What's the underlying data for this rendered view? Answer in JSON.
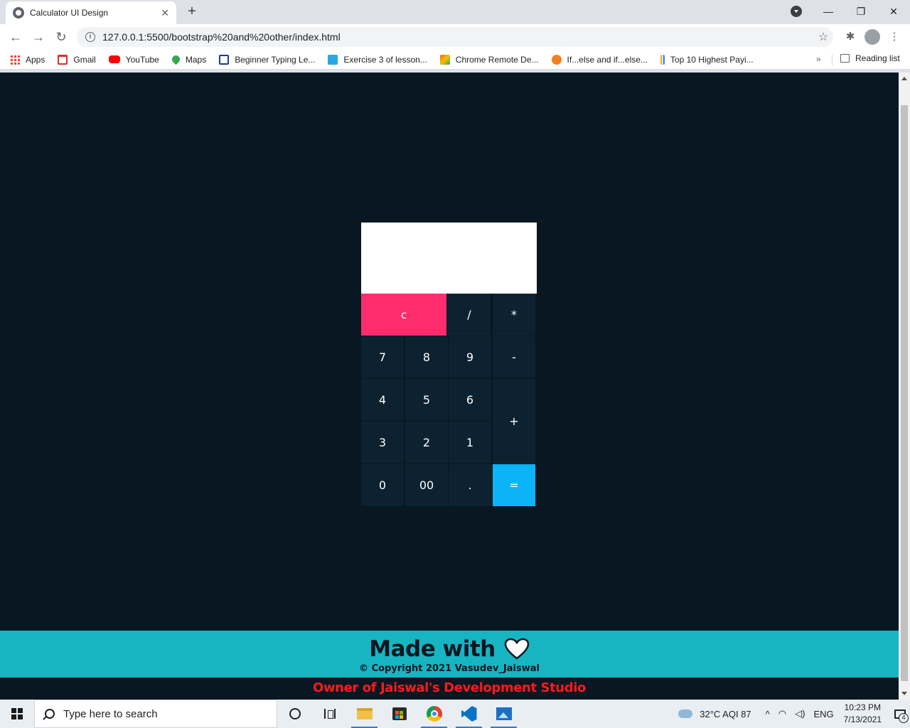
{
  "browser": {
    "tab_title": "Calculator UI Design",
    "tab_close": "✕",
    "new_tab": "+",
    "url": "127.0.0.1:5500/bootstrap%20and%20other/index.html",
    "window_controls": {
      "minimize": "—",
      "restore": "❐",
      "close": "✕"
    },
    "nav": {
      "back": "←",
      "forward": "→",
      "reload": "↻"
    },
    "star": "☆",
    "extensions": "✱",
    "menu": "⋮",
    "bookmarks": [
      {
        "label": "Apps",
        "color": "#ea4335"
      },
      {
        "label": "Gmail",
        "color": "#d93025"
      },
      {
        "label": "YouTube",
        "color": "#ff0000"
      },
      {
        "label": "Maps",
        "color": "#34a853"
      },
      {
        "label": "Beginner Typing Le...",
        "color": "#1a3d8f"
      },
      {
        "label": "Exercise 3 of lesson...",
        "color": "#29a8e0"
      },
      {
        "label": "Chrome Remote De...",
        "color": "#e8710a"
      },
      {
        "label": "If...else and if...else...",
        "color": "#f48024"
      },
      {
        "label": "Top 10 Highest Payi...",
        "color": "#f9ab00"
      }
    ],
    "bookmarks_more": "»",
    "reading_list": "Reading list"
  },
  "calculator": {
    "display_value": "",
    "keys": [
      {
        "label": "c",
        "type": "clear",
        "name": "clear-button"
      },
      {
        "label": "/",
        "type": "operator",
        "name": "divide-button"
      },
      {
        "label": "*",
        "type": "operator",
        "name": "multiply-button"
      },
      {
        "label": "7",
        "type": "digit",
        "name": "digit-7-button"
      },
      {
        "label": "8",
        "type": "digit",
        "name": "digit-8-button"
      },
      {
        "label": "9",
        "type": "digit",
        "name": "digit-9-button"
      },
      {
        "label": "-",
        "type": "operator",
        "name": "subtract-button"
      },
      {
        "label": "4",
        "type": "digit",
        "name": "digit-4-button"
      },
      {
        "label": "5",
        "type": "digit",
        "name": "digit-5-button"
      },
      {
        "label": "6",
        "type": "digit",
        "name": "digit-6-button"
      },
      {
        "label": "+",
        "type": "plus",
        "name": "add-button"
      },
      {
        "label": "3",
        "type": "digit",
        "name": "digit-3-button"
      },
      {
        "label": "2",
        "type": "digit",
        "name": "digit-2-button"
      },
      {
        "label": "1",
        "type": "digit",
        "name": "digit-1-button"
      },
      {
        "label": "0",
        "type": "digit",
        "name": "digit-0-button"
      },
      {
        "label": "00",
        "type": "digit",
        "name": "double-zero-button"
      },
      {
        "label": ".",
        "type": "digit",
        "name": "decimal-button"
      },
      {
        "label": "=",
        "type": "equal",
        "name": "equals-button"
      }
    ],
    "colors": {
      "clear": "#ff2d6e",
      "equal": "#0bb3f7",
      "key": "#0c2230",
      "page": "#081721"
    }
  },
  "footer": {
    "made_with": "Made with",
    "copyright": "© Copyright 2021 Vasudev_Jaiswal",
    "owner": "Owner of Jaiswal's Development Studio",
    "bar_color": "#17b5c2"
  },
  "taskbar": {
    "search_placeholder": "Type here to search",
    "weather": "32°C  AQI 87",
    "chevron": "^",
    "lang": "ENG",
    "time": "10:23 PM",
    "date": "7/13/2021",
    "notifications": "4"
  }
}
